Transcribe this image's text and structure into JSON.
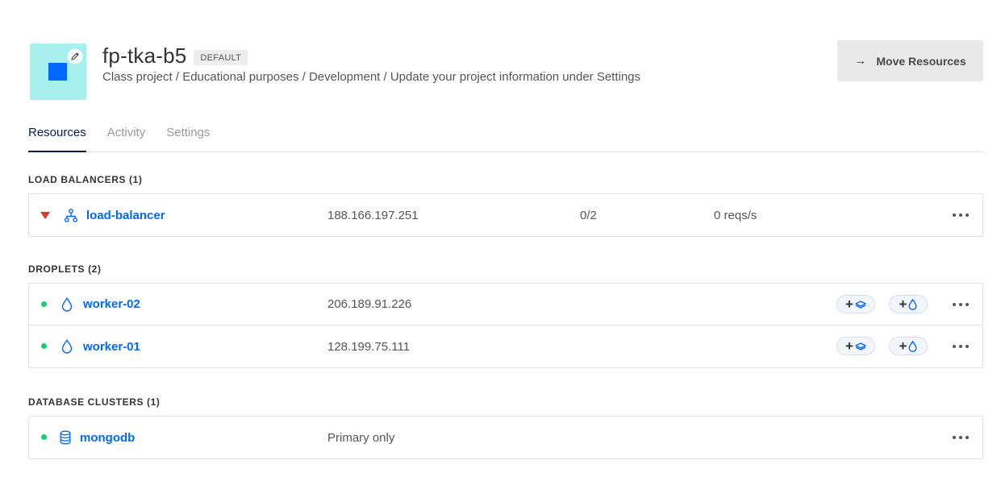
{
  "project": {
    "name": "fp-tka-b5",
    "badge": "DEFAULT",
    "description": "Class project / Educational purposes / Development / Update your project information under Settings",
    "move_button_arrow": "→",
    "move_button_label": "Move Resources"
  },
  "tabs": [
    {
      "label": "Resources",
      "active": true
    },
    {
      "label": "Activity",
      "active": false
    },
    {
      "label": "Settings",
      "active": false
    }
  ],
  "load_balancers": {
    "title": "LOAD BALANCERS (1)",
    "items": [
      {
        "name": "load-balancer",
        "ip": "188.166.197.251",
        "droplets": "0/2",
        "requests": "0 reqs/s",
        "status": "down"
      }
    ]
  },
  "droplets": {
    "title": "DROPLETS (2)",
    "add_volume_label": "+",
    "add_floating_ip_label": "+",
    "items": [
      {
        "name": "worker-02",
        "ip": "206.189.91.226",
        "status": "active"
      },
      {
        "name": "worker-01",
        "ip": "128.199.75.111",
        "status": "active"
      }
    ]
  },
  "database_clusters": {
    "title": "DATABASE CLUSTERS (1)",
    "items": [
      {
        "name": "mongodb",
        "config": "Primary only",
        "status": "active"
      }
    ]
  },
  "colors": {
    "accent": "#0069ff",
    "active_tab": "#031b4e",
    "status_active": "#15cd72",
    "status_down": "#e0362c",
    "project_icon_bg": "#a8f0ee"
  },
  "icons": {
    "project": "project-square-icon",
    "edit": "pencil-icon",
    "load_balancer": "load-balancer-icon",
    "droplet": "droplet-icon",
    "database": "database-icon",
    "more": "more-horizontal-icon",
    "volume": "volume-icon"
  }
}
